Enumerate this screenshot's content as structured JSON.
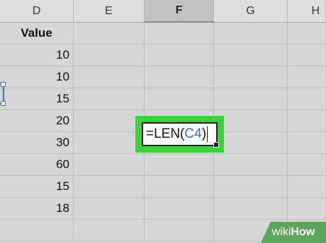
{
  "columns": [
    "D",
    "E",
    "F",
    "G",
    "H"
  ],
  "selected_column": "F",
  "column_d": {
    "header": "Value",
    "values": [
      "10",
      "10",
      "15",
      "20",
      "30",
      "60",
      "15",
      "18",
      "",
      ""
    ]
  },
  "editor": {
    "prefix": "=LEN(",
    "reference": "C4",
    "suffix": ")"
  },
  "watermark": {
    "brand_1": "wiki",
    "brand_2": "How"
  },
  "colors": {
    "highlight": "#3bd13b",
    "reference": "#3f6bb8",
    "selection_border": "#4a6fb5"
  }
}
